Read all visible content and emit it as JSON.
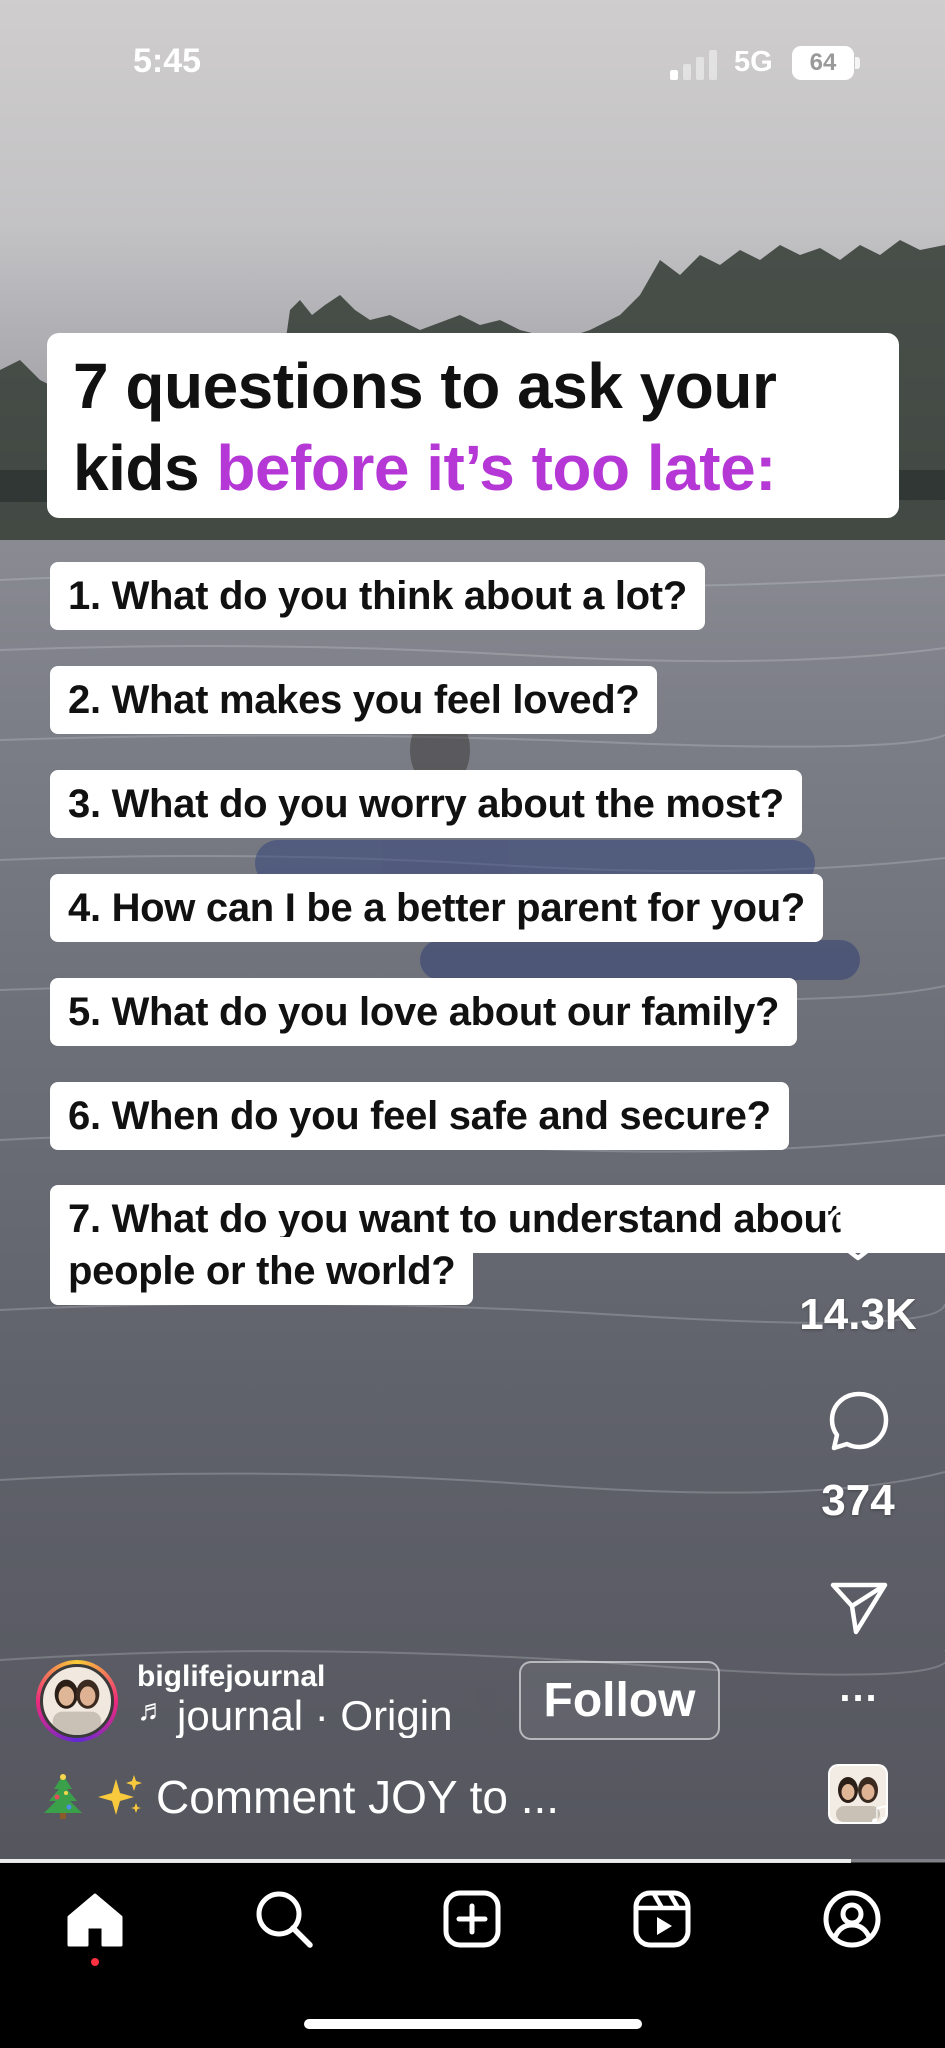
{
  "status_bar": {
    "time": "5:45",
    "network": "5G",
    "battery": "64"
  },
  "reel": {
    "headline_line1": "7 questions to ask your",
    "headline_line2_plain": "kids ",
    "headline_line2_accent": "before it’s too late:",
    "questions": [
      "1. What do you think about a lot?",
      "2. What makes you feel loved?",
      "3. What do you worry about the most?",
      "4. How can I be a better parent for you?",
      "5. What do you love about our family?",
      "6. When do you feel safe and secure?"
    ],
    "question_7_line1": "7. What do you want to understand about",
    "question_7_line2": "people or the world?",
    "accent_color": "#b537d6"
  },
  "actions": {
    "likes": "14.3K",
    "comments": "374",
    "like_icon": "heart-icon",
    "comment_icon": "comment-bubble-icon",
    "share_icon": "paper-plane-icon",
    "more_icon": "more-dots-icon"
  },
  "creator": {
    "username": "biglifejournal",
    "audio_note": "♬",
    "audio_text": "journal · Origin",
    "follow_label": "Follow",
    "more_label": "..."
  },
  "caption": {
    "text": "Comment JOY  to ...",
    "emoji_1": "christmas-tree-emoji",
    "emoji_2": "sparkles-emoji"
  },
  "audio_thumb": {
    "note": "♫"
  },
  "progress": {
    "fraction": 0.9
  },
  "tabbar": {
    "active_tab": "home",
    "tabs": [
      "home",
      "search",
      "create",
      "reels",
      "profile"
    ],
    "notification_color": "#ff3040"
  }
}
